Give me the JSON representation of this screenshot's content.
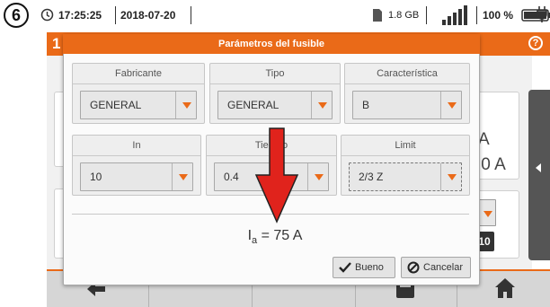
{
  "step_badge": "6",
  "status_bar": {
    "time": "17:25:25",
    "date": "2018-07-20",
    "storage": "1.8 GB",
    "battery": "100 %"
  },
  "background": {
    "screen_number": "1",
    "card_values": [
      "A",
      ",0 A",
      "10"
    ]
  },
  "dialog": {
    "title": "Parámetros del fusible",
    "groups": [
      {
        "label": "Fabricante",
        "value": "GENERAL"
      },
      {
        "label": "Tipo",
        "value": "GENERAL"
      },
      {
        "label": "Característica",
        "value": "B"
      },
      {
        "label": "In",
        "value": "10"
      },
      {
        "label": "Tiempo",
        "value": "0.4"
      },
      {
        "label": "Limit",
        "value": "2/3 Z"
      }
    ],
    "result_symbol": "I",
    "result_subscript": "a",
    "result_value": " = 75 A",
    "ok_label": "Bueno",
    "cancel_label": "Cancelar"
  },
  "annotation": {
    "arrow_color": "#e0231c"
  },
  "colors": {
    "accent": "#ea6a18",
    "bottom_bar": "#d6d6d6"
  }
}
